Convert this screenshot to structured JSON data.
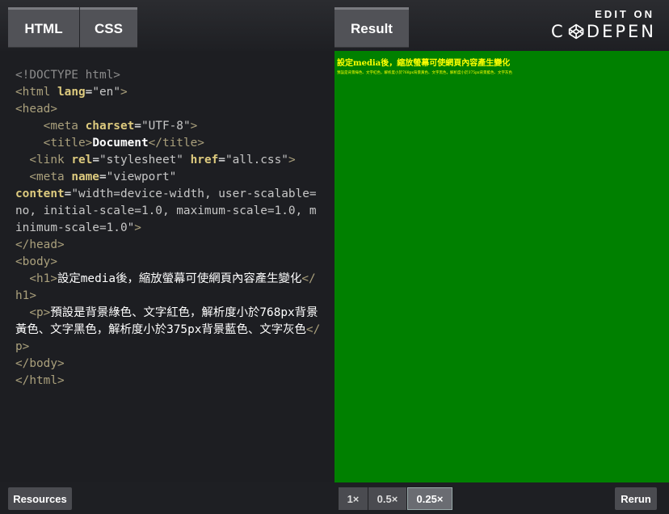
{
  "header": {
    "tabs": {
      "html": "HTML",
      "css": "CSS",
      "result": "Result"
    },
    "brand": {
      "edit_on": "EDIT ON",
      "logo_c": "C",
      "logo_rest": "DEPEN"
    }
  },
  "code": {
    "doctype": "<!DOCTYPE html>",
    "html_open_tag": "<html",
    "lang_attr": " lang",
    "lang_value": "\"en\"",
    "html_open_close": ">",
    "head_open": "<head>",
    "meta_charset_tag": "<meta",
    "charset_attr": " charset",
    "charset_value": "\"UTF-8\"",
    "meta_charset_close": ">",
    "title_open": "<title>",
    "title_text": "Document",
    "title_close": "</title>",
    "link_tag": "<link",
    "rel_attr": " rel",
    "rel_value": "\"stylesheet\"",
    "href_attr": " href",
    "href_value": "\"all.css\"",
    "link_close": ">",
    "meta_viewport_tag": "<meta",
    "name_attr": " name",
    "name_value": "\"viewport\"",
    "content_attr": "content",
    "content_value": "\"width=device-width, user-scalable=no, initial-scale=1.0, maximum-scale=1.0, minimum-scale=1.0\"",
    "meta_viewport_close": ">",
    "head_close": "</head>",
    "body_open": "<body>",
    "h1_open": "<h1>",
    "h1_text": "設定media後，縮放螢幕可使網頁內容產生變化",
    "h1_close": "</h1>",
    "p_open": "<p>",
    "p_text": "預設是背景綠色、文字紅色，解析度小於768px背景黃色、文字黑色，解析度小於375px背景藍色、文字灰色",
    "p_close": "</p>",
    "body_close": "</body>",
    "html_close": "</html>"
  },
  "result": {
    "h1": "設定media後，縮放螢幕可使網頁內容產生變化",
    "p": "預設是背景綠色、文字紅色，解析度小於768px背景黃色、文字黑色，解析度小於375px背景藍色、文字灰色",
    "background_color": "#008000",
    "text_color": "#ffff00"
  },
  "footer": {
    "resources": "Resources",
    "zoom_options": [
      "1×",
      "0.5×",
      "0.25×"
    ],
    "zoom_selected": "0.25×",
    "rerun": "Rerun"
  }
}
